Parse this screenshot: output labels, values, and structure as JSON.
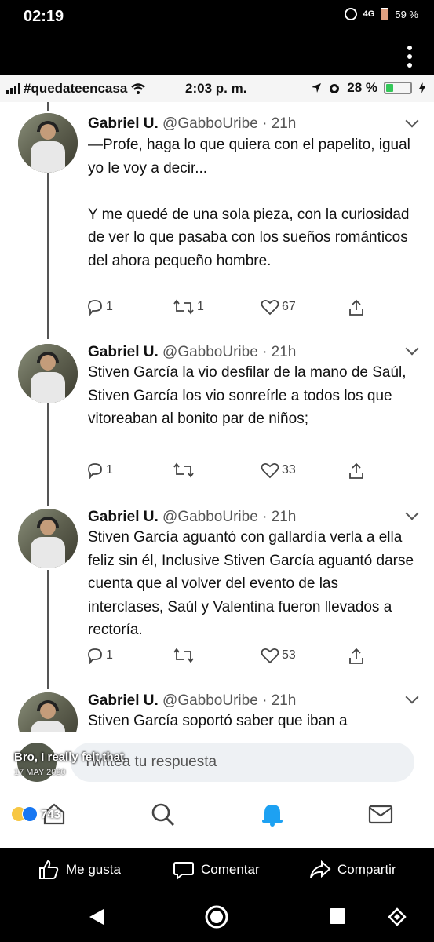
{
  "outer_status": {
    "time": "02:19",
    "network": "4G",
    "battery": "59 %"
  },
  "ios_status": {
    "carrier": "#quedateencasa",
    "time": "2:03 p. m.",
    "battery": "28 %"
  },
  "tweets": [
    {
      "name": "Gabriel U.",
      "handle": "@GabboUribe",
      "time": "· 21h",
      "text": "—Profe, haga lo que quiera con el papelito, igual yo le voy a decir...\n\nY me quedé de una sola pieza, con la curiosidad de ver lo que pasaba con los sueños románticos del ahora pequeño hombre.",
      "replies": "1",
      "retweets": "1",
      "likes": "67"
    },
    {
      "name": "Gabriel U.",
      "handle": "@GabboUribe",
      "time": "· 21h",
      "text": "Stiven García la vio desfilar de la mano de Saúl, Stiven García los vio sonreírle a todos los que vitoreaban al bonito par de niños;",
      "replies": "1",
      "retweets": "",
      "likes": "33"
    },
    {
      "name": "Gabriel U.",
      "handle": "@GabboUribe",
      "time": "· 21h",
      "text": "Stiven García aguantó con gallardía verla a ella feliz sin él, Inclusive Stiven García aguantó darse cuenta que al volver del evento de las interclases, Saúl y Valentina fueron llevados a rectoría.",
      "replies": "1",
      "retweets": "",
      "likes": "53"
    },
    {
      "name": "Gabriel U.",
      "handle": "@GabboUribe",
      "time": "· 21h",
      "text": "Stiven García soportó saber que iban a",
      "replies": "",
      "retweets": "",
      "likes": ""
    }
  ],
  "reply": {
    "placeholder": "Twittea tu respuesta"
  },
  "overlay": {
    "comment": "Bro, I really felt that",
    "date": "17 MAY 2020",
    "reaction_count": "743"
  },
  "fb_actions": {
    "like": "Me gusta",
    "comment": "Comentar",
    "share": "Compartir"
  },
  "icons": {
    "twitter_reply": "reply-icon",
    "twitter_retweet": "retweet-icon",
    "twitter_like": "heart-icon",
    "twitter_share": "share-icon",
    "tab_search": "search-icon",
    "tab_notifications": "bell-icon",
    "tab_messages": "mail-icon"
  }
}
